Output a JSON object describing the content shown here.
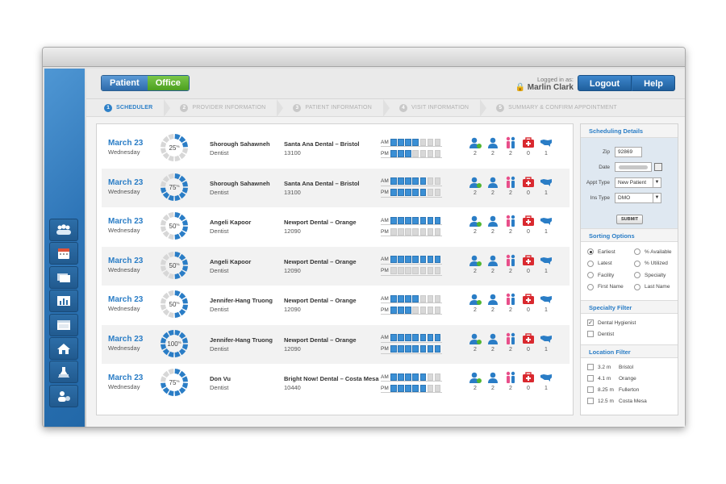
{
  "header": {
    "toggle": [
      "Patient",
      "Office"
    ],
    "logged_in_label": "Logged in as:",
    "user_name": "Marlin Clark",
    "logout": "Logout",
    "help": "Help"
  },
  "steps": [
    {
      "num": "1",
      "label": "SCHEDULER",
      "active": true
    },
    {
      "num": "2",
      "label": "PROVIDER INFORMATION",
      "active": false
    },
    {
      "num": "3",
      "label": "PATIENT INFORMATION",
      "active": false
    },
    {
      "num": "4",
      "label": "VISIT INFORMATION",
      "active": false
    },
    {
      "num": "5",
      "label": "SUMMARY & CONFIRM APPOINTMENT",
      "active": false
    }
  ],
  "rows": [
    {
      "date": "March 23",
      "day": "Wednesday",
      "pct": 25,
      "provider": "Shorough Sahawneh",
      "role": "Dentist",
      "facility": "Santa Ana Dental – Bristol",
      "zip": "13100",
      "am": 4,
      "pm": 3,
      "counts": [
        "2",
        "2",
        "2",
        "0",
        "1"
      ]
    },
    {
      "date": "March 23",
      "day": "Wednesday",
      "pct": 75,
      "provider": "Shorough Sahawneh",
      "role": "Dentist",
      "facility": "Santa Ana Dental – Bristol",
      "zip": "13100",
      "am": 5,
      "pm": 5,
      "counts": [
        "2",
        "2",
        "2",
        "0",
        "1"
      ]
    },
    {
      "date": "March 23",
      "day": "Wednesday",
      "pct": 50,
      "provider": "Angeli Kapoor",
      "role": "Dentist",
      "facility": "Newport Dental – Orange",
      "zip": "12090",
      "am": 7,
      "pm": 0,
      "counts": [
        "2",
        "2",
        "2",
        "0",
        "1"
      ]
    },
    {
      "date": "March 23",
      "day": "Wednesday",
      "pct": 50,
      "provider": "Angeli Kapoor",
      "role": "Dentist",
      "facility": "Newport Dental – Orange",
      "zip": "12090",
      "am": 7,
      "pm": 0,
      "counts": [
        "2",
        "2",
        "2",
        "0",
        "1"
      ]
    },
    {
      "date": "March 23",
      "day": "Wednesday",
      "pct": 50,
      "provider": "Jennifer-Hang Truong",
      "role": "Dentist",
      "facility": "Newport Dental – Orange",
      "zip": "12090",
      "am": 4,
      "pm": 3,
      "counts": [
        "2",
        "2",
        "2",
        "0",
        "1"
      ]
    },
    {
      "date": "March 23",
      "day": "Wednesday",
      "pct": 100,
      "provider": "Jennifer-Hang Truong",
      "role": "Dentist",
      "facility": "Newport Dental – Orange",
      "zip": "12090",
      "am": 7,
      "pm": 7,
      "counts": [
        "2",
        "2",
        "2",
        "0",
        "1"
      ]
    },
    {
      "date": "March 23",
      "day": "Wednesday",
      "pct": 75,
      "provider": "Don Vu",
      "role": "Dentist",
      "facility": "Bright Now! Dental – Costa Mesa",
      "zip": "10440",
      "am": 5,
      "pm": 5,
      "counts": [
        "2",
        "2",
        "2",
        "0",
        "1"
      ]
    }
  ],
  "panel": {
    "sched_title": "Scheduling Details",
    "zip_label": "Zip",
    "zip_value": "92869",
    "date_label": "Date",
    "appt_label": "Appt Type",
    "appt_value": "New Patient",
    "ins_label": "Ins Type",
    "ins_value": "DMO",
    "submit": "SUBMIT",
    "sort_title": "Sorting Options",
    "sort_left": [
      "Earliest",
      "Latest",
      "Facility",
      "First Name"
    ],
    "sort_right": [
      "% Available",
      "% Utilized",
      "Specialty",
      "Last Name"
    ],
    "spec_title": "Specialty Filter",
    "specialties": [
      {
        "label": "Dental Hygienist",
        "checked": true
      },
      {
        "label": "Dentist",
        "checked": false
      }
    ],
    "loc_title": "Location Filter",
    "locations": [
      {
        "dist": "3.2 m",
        "name": "Bristol"
      },
      {
        "dist": "4.1 m",
        "name": "Orange"
      },
      {
        "dist": "8.25 m",
        "name": "Fullerton"
      },
      {
        "dist": "12.5 m",
        "name": "Costa Mesa"
      }
    ]
  },
  "sidebar_icons": [
    "group-icon",
    "calendar-icon",
    "cards-icon",
    "chart-icon",
    "windows-icon",
    "house-icon",
    "lab-flask-icon",
    "user-settings-icon"
  ],
  "amenity_icons": [
    "user-add-icon",
    "user-icon",
    "family-icon",
    "first-aid-kit-icon",
    "usa-map-icon"
  ],
  "colors": {
    "accent": "#2a7dc6",
    "office_green": "#5aad2c",
    "slot_on": "#3a8fd5",
    "slot_off": "#d8d8d8",
    "medkit_red": "#d9292f",
    "pink": "#e84f8a"
  }
}
